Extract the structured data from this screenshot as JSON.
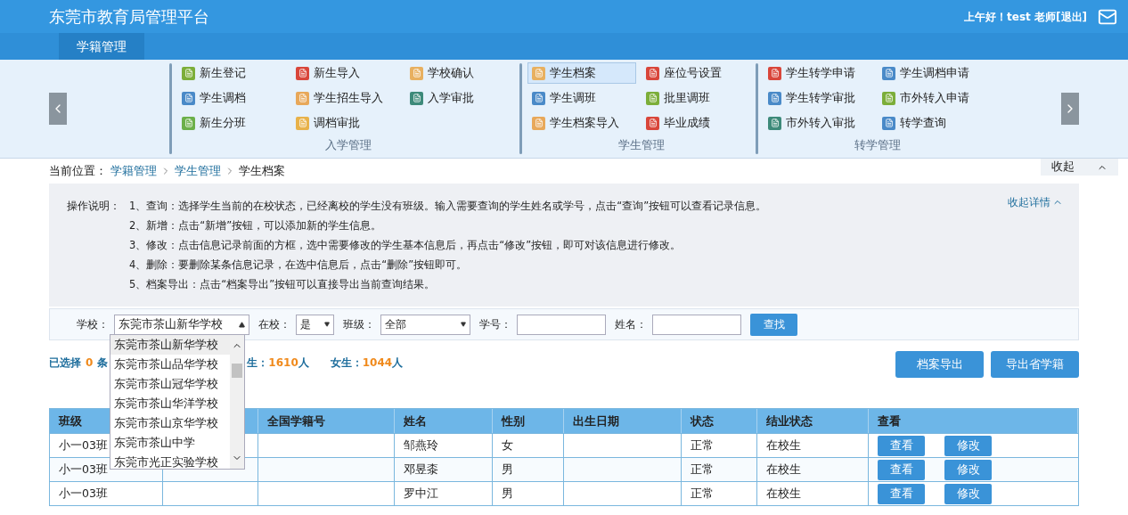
{
  "header": {
    "title": "东莞市教育局管理平台",
    "greeting": "上午好！test 老师[退出]"
  },
  "nav": {
    "tabs": [
      {
        "label": "学籍管理",
        "selected": true
      }
    ]
  },
  "ribbon": {
    "groups": [
      {
        "label": "入学管理",
        "columns": [
          [
            {
              "label": "新生登记",
              "color": "#7cae3a",
              "selected": false
            },
            {
              "label": "学生调档",
              "color": "#4a8ac8",
              "selected": false
            },
            {
              "label": "新生分班",
              "color": "#6cb04a",
              "selected": false
            }
          ],
          [
            {
              "label": "新生导入",
              "color": "#d9463b",
              "selected": false
            },
            {
              "label": "学生招生导入",
              "color": "#e8a85a",
              "selected": false
            },
            {
              "label": "调档审批",
              "color": "#e8b24a",
              "selected": false
            }
          ],
          [
            {
              "label": "学校确认",
              "color": "#e8b060",
              "selected": false
            },
            {
              "label": "入学审批",
              "color": "#3d8a7a",
              "selected": false
            }
          ]
        ]
      },
      {
        "label": "学生管理",
        "columns": [
          [
            {
              "label": "学生档案",
              "color": "#e8b060",
              "selected": true
            },
            {
              "label": "学生调班",
              "color": "#4a8ac8",
              "selected": false
            },
            {
              "label": "学生档案导入",
              "color": "#e8a85a",
              "selected": false
            }
          ],
          [
            {
              "label": "座位号设置",
              "color": "#d9463b",
              "selected": false
            },
            {
              "label": "批里调班",
              "color": "#7cae3a",
              "selected": false
            },
            {
              "label": "毕业成绩",
              "color": "#d9463b",
              "selected": false
            }
          ]
        ]
      },
      {
        "label": "转学管理",
        "columns": [
          [
            {
              "label": "学生转学申请",
              "color": "#d9463b",
              "selected": false
            },
            {
              "label": "学生转学审批",
              "color": "#4a8ac8",
              "selected": false
            },
            {
              "label": "市外转入审批",
              "color": "#3d8a7a",
              "selected": false
            }
          ],
          [
            {
              "label": "学生调档申请",
              "color": "#4a8ac8",
              "selected": false
            },
            {
              "label": "市外转入申请",
              "color": "#7cae3a",
              "selected": false
            },
            {
              "label": "转学查询",
              "color": "#4a8ac8",
              "selected": false
            }
          ]
        ]
      }
    ],
    "collapse": "收起"
  },
  "breadcrumb": {
    "label": "当前位置：",
    "links": [
      "学籍管理",
      "学生管理"
    ],
    "current": "学生档案"
  },
  "instructions": {
    "label": "操作说明：",
    "toggle": "收起详情",
    "lines": [
      "1、查询：选择学生当前的在校状态，已经离校的学生没有班级。输入需要查询的学生姓名或学号，点击“查询”按钮可以查看记录信息。",
      "2、新增：点击“新增”按钮，可以添加新的学生信息。",
      "3、修改：点击信息记录前面的方框，选中需要修改的学生基本信息后，再点击“修改”按钮，即可对该信息进行修改。",
      "4、删除：要删除某条信息记录，在选中信息后，点击“删除”按钮即可。",
      "5、档案导出：点击“档案导出”按钮可以直接导出当前查询结果。"
    ]
  },
  "filters": {
    "school": {
      "label": "学校：",
      "value": "东莞市茶山新华学校",
      "expanded": true,
      "options": [
        {
          "label": "东莞市茶山新华学校",
          "selected": true
        },
        {
          "label": "东莞市茶山品华学校",
          "selected": false
        },
        {
          "label": "东莞市茶山冠华学校",
          "selected": false
        },
        {
          "label": "东莞市茶山华洋学校",
          "selected": false
        },
        {
          "label": "东莞市茶山京华学校",
          "selected": false
        },
        {
          "label": "东莞市茶山中学",
          "selected": false
        },
        {
          "label": "东莞市光正实验学校",
          "selected": false
        }
      ]
    },
    "in_school": {
      "label": "在校：",
      "value": "是"
    },
    "class": {
      "label": "班级：",
      "value": "全部"
    },
    "student_no": {
      "label": "学号："
    },
    "name": {
      "label": "姓名："
    },
    "search_button": "查找"
  },
  "stats": {
    "selected_label": "已选择",
    "selected_count": "0",
    "selected_unit": "条",
    "male_label": "生：",
    "male_count": "1610",
    "male_unit": "人",
    "female_label": "女生：",
    "female_count": "1044",
    "female_unit": "人"
  },
  "actions": [
    "档案导出",
    "导出省学籍"
  ],
  "table": {
    "columns": [
      "班级",
      "",
      "全国学籍号",
      "姓名",
      "性别",
      "出生日期",
      "状态",
      "结业状态",
      "查看"
    ],
    "rows": [
      {
        "cells": [
          "小一03班",
          "",
          "",
          "邹燕玲",
          "女",
          "",
          "正常",
          "在校生"
        ],
        "buttons": [
          "查看",
          "修改"
        ]
      },
      {
        "cells": [
          "小一03班",
          "",
          "",
          "邓昱桼",
          "男",
          "",
          "正常",
          "在校生"
        ],
        "buttons": [
          "查看",
          "修改"
        ]
      },
      {
        "cells": [
          "小一03班",
          "",
          "",
          "罗中江",
          "男",
          "",
          "正常",
          "在校生"
        ],
        "buttons": [
          "查看",
          "修改"
        ]
      }
    ]
  }
}
